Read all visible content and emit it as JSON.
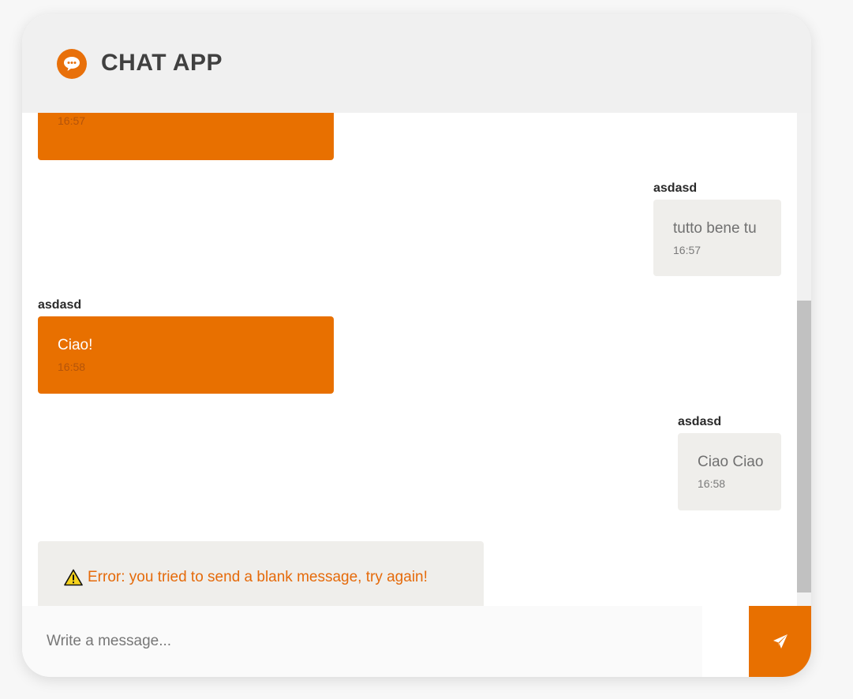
{
  "app": {
    "title": "CHAT APP",
    "logo_icon": "chat-bubble-icon",
    "accent_color": "#e87000"
  },
  "messages": [
    {
      "sender": "",
      "text": "",
      "time": "16:57",
      "side": "left",
      "partially_visible": true
    },
    {
      "sender": "asdasd",
      "text": "tutto bene tu",
      "time": "16:57",
      "side": "right"
    },
    {
      "sender": "asdasd",
      "text": "Ciao!",
      "time": "16:58",
      "side": "left"
    },
    {
      "sender": "asdasd",
      "text": "Ciao Ciao",
      "time": "16:58",
      "side": "right"
    }
  ],
  "error": {
    "icon": "warning-icon",
    "text": "Error: you tried to send a blank message, try again!"
  },
  "composer": {
    "placeholder": "Write a message...",
    "value": "",
    "send_icon": "paper-plane-icon"
  }
}
